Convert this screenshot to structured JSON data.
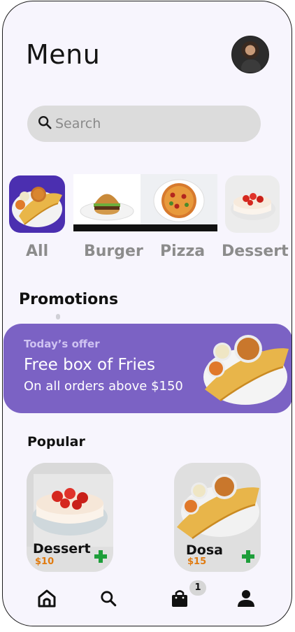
{
  "header": {
    "title": "Menu"
  },
  "search": {
    "placeholder": "Search"
  },
  "categories": [
    {
      "label": "All"
    },
    {
      "label": "Burger"
    },
    {
      "label": "Pizza"
    },
    {
      "label": "Dessert"
    }
  ],
  "promotions": {
    "heading": "Promotions",
    "offer_tag": "Today’s offer",
    "offer_title": "Free box of Fries",
    "offer_subtitle": "On all orders above $150"
  },
  "popular": {
    "heading": "Popular",
    "items": [
      {
        "name": "Dessert",
        "price": "$10"
      },
      {
        "name": "Dosa",
        "price": "$15"
      }
    ]
  },
  "bottom_nav": {
    "items": [
      "home-icon",
      "search-icon",
      "shopping-bag-icon",
      "profile-icon"
    ],
    "cart_count": "1"
  },
  "colors": {
    "accent": "#7b62c4",
    "price": "#e07b10",
    "add_button": "#1e9e3a",
    "background": "#f7f5fd"
  }
}
